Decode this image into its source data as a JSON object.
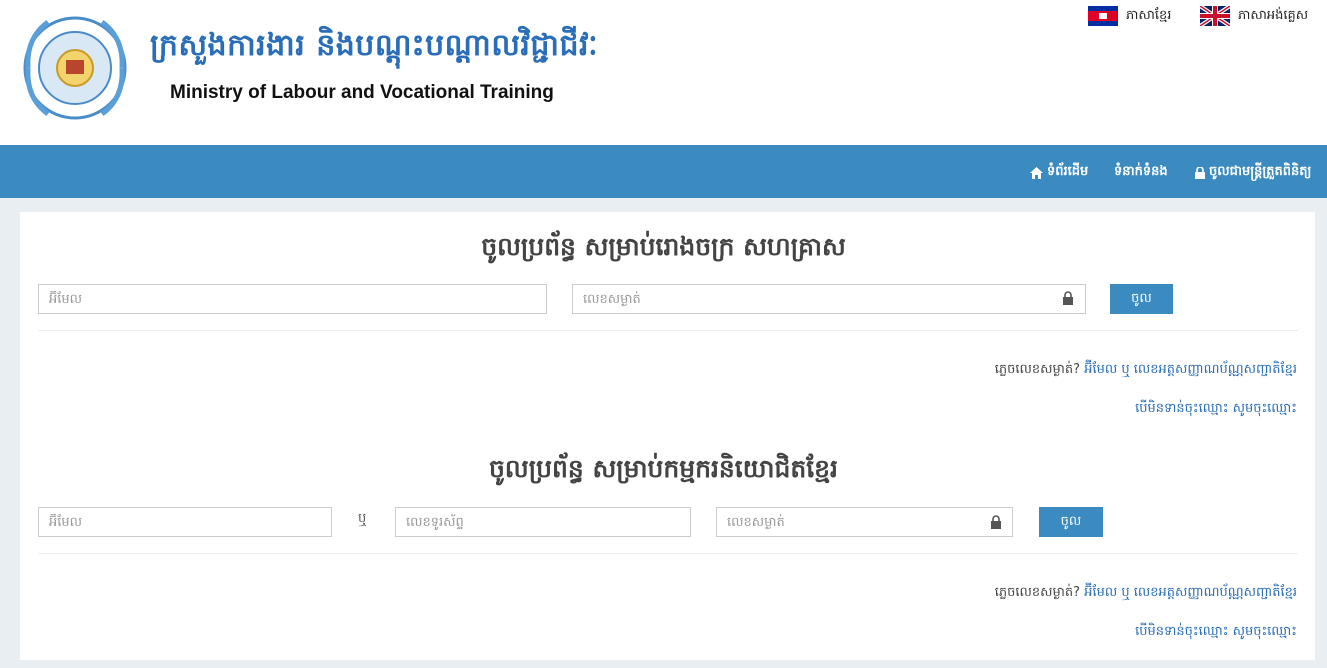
{
  "header": {
    "title_kh": "ក្រសួងការងារ និងបណ្តុះបណ្តាលវិជ្ជាជីវៈ",
    "title_en": "Ministry of Labour and Vocational Training",
    "lang_kh": "ភាសាខ្មែរ",
    "lang_en": "ភាសាអង់គ្លេស"
  },
  "nav": {
    "home": "ទំព័រដើម",
    "contact": "ទំនាក់ទំនង",
    "officer_login": "ចូលជាមន្ត្រីត្រួតពិនិត្យ"
  },
  "enterprise_section": {
    "title": "ចូលប្រព័ន្ធ សម្រាប់រោងចក្រ សហគ្រាស",
    "email_placeholder": "អ៊ីមែល",
    "password_placeholder": "លេខសម្ងាត់",
    "login_label": "ចូល",
    "forgot_label": "ភ្លេចលេខសម្ងាត់?",
    "forgot_link": "អ៊ីមែល ឬ លេខអត្តសញ្ញាណប័ណ្ណសញ្ជាតិខ្មែរ",
    "register_link": "បើមិនទាន់ចុះឈ្មោះ សូមចុះឈ្មោះ"
  },
  "worker_section": {
    "title": "ចូលប្រព័ន្ធ សម្រាប់កម្មករនិយោជិតខ្មែរ",
    "email_placeholder": "អ៊ីមែល",
    "or_label": "ឬ",
    "phone_placeholder": "លេខទូរស័ព្ទ",
    "password_placeholder": "លេខសម្ងាត់",
    "login_label": "ចូល",
    "forgot_label": "ភ្លេចលេខសម្ងាត់?",
    "forgot_link": "អ៊ីមែល ឬ លេខអត្តសញ្ញាណប័ណ្ណសញ្ជាតិខ្មែរ",
    "register_link": "បើមិនទាន់ចុះឈ្មោះ សូមចុះឈ្មោះ"
  },
  "colors": {
    "nav_bg": "#3b8bc0",
    "title_blue": "#2a6db8",
    "link": "#2a6db8",
    "page_bg": "#e9eef2"
  }
}
